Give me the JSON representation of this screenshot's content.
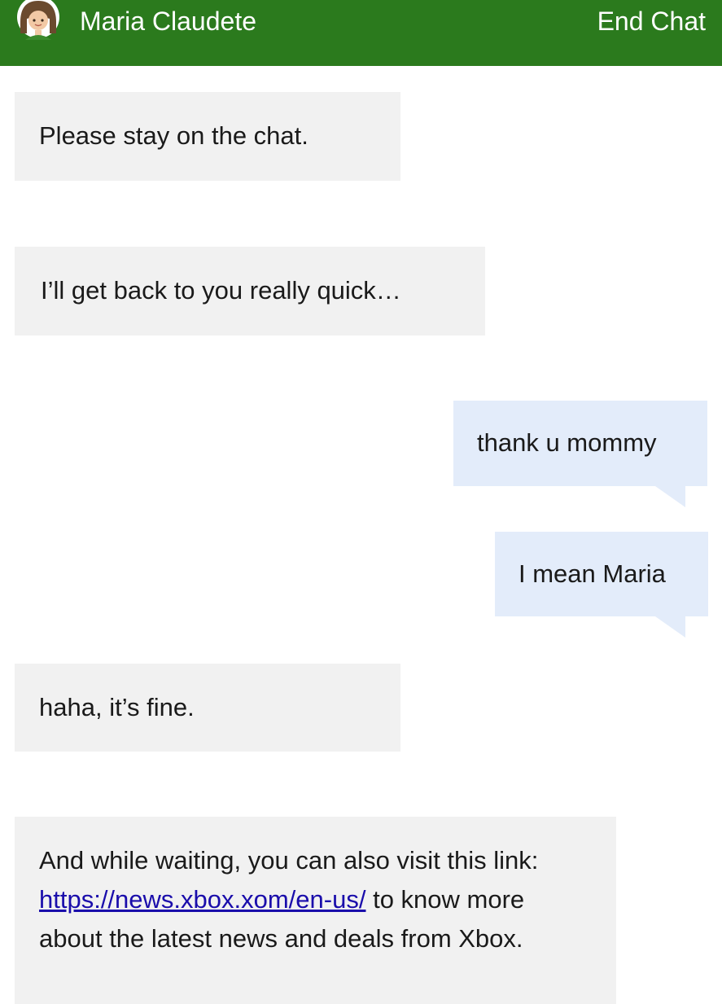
{
  "header": {
    "agent_name": "Maria Claudete",
    "end_chat_label": "End Chat",
    "brand_color": "#2b7a1d"
  },
  "messages": [
    {
      "sender": "agent",
      "text": "Please stay on the chat."
    },
    {
      "sender": "agent",
      "text": "I’ll get back to you really quick…"
    },
    {
      "sender": "user",
      "text": "thank u mommy"
    },
    {
      "sender": "user",
      "text": "I mean Maria"
    },
    {
      "sender": "agent",
      "text": "haha, it’s fine."
    },
    {
      "sender": "agent",
      "text_before": "And while waiting, you can also visit this link: ",
      "link": "https://news.xbox.xom/en-us/",
      "text_after": " to know more about the latest news and deals from Xbox."
    }
  ],
  "colors": {
    "agent_bubble": "#f1f1f1",
    "user_bubble": "#e3ecfa",
    "link": "#1a0dab"
  }
}
